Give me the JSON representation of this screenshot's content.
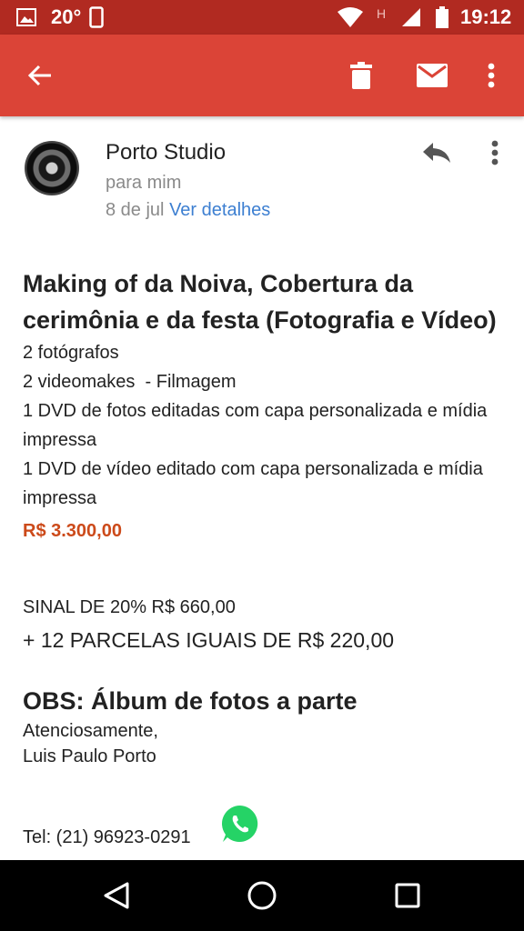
{
  "status_bar": {
    "temperature": "20°",
    "network_letter": "H",
    "time": "19:12",
    "icons": [
      "image-icon",
      "phone-icon",
      "wifi-icon",
      "signal-icon",
      "battery-icon"
    ]
  },
  "app_bar": {
    "icons": [
      "back-arrow-icon",
      "trash-icon",
      "mail-icon",
      "more-vert-icon"
    ]
  },
  "email": {
    "sender": "Porto Studio",
    "to": "para mim",
    "date": "8 de jul",
    "details_link": "Ver detalhes",
    "headline": "Making of da Noiva, Cobertura da cerimônia e da festa (Fotografia e Vídeo)",
    "items": [
      "2 fotógrafos",
      "2 videomakes  - Filmagem",
      "1 DVD de fotos editadas com capa personalizada e mídia impressa",
      "1 DVD de vídeo editado com capa personalizada e mídia impressa"
    ],
    "price": "R$ 3.300,00",
    "sinal": "SINAL DE 20% R$ 660,00",
    "parcelas": "+ 12 PARCELAS IGUAIS DE R$ 220,00",
    "obs": "OBS: Álbum de fotos a parte",
    "closing": "Atenciosamente,",
    "signature": "Luis Paulo Porto",
    "tel": "Tel: (21) 96923-0291"
  },
  "colors": {
    "status_bar": "#b12a21",
    "app_bar": "#db4437",
    "price": "#cc4a1a",
    "link": "#3d7fd1",
    "whatsapp": "#25d366"
  }
}
